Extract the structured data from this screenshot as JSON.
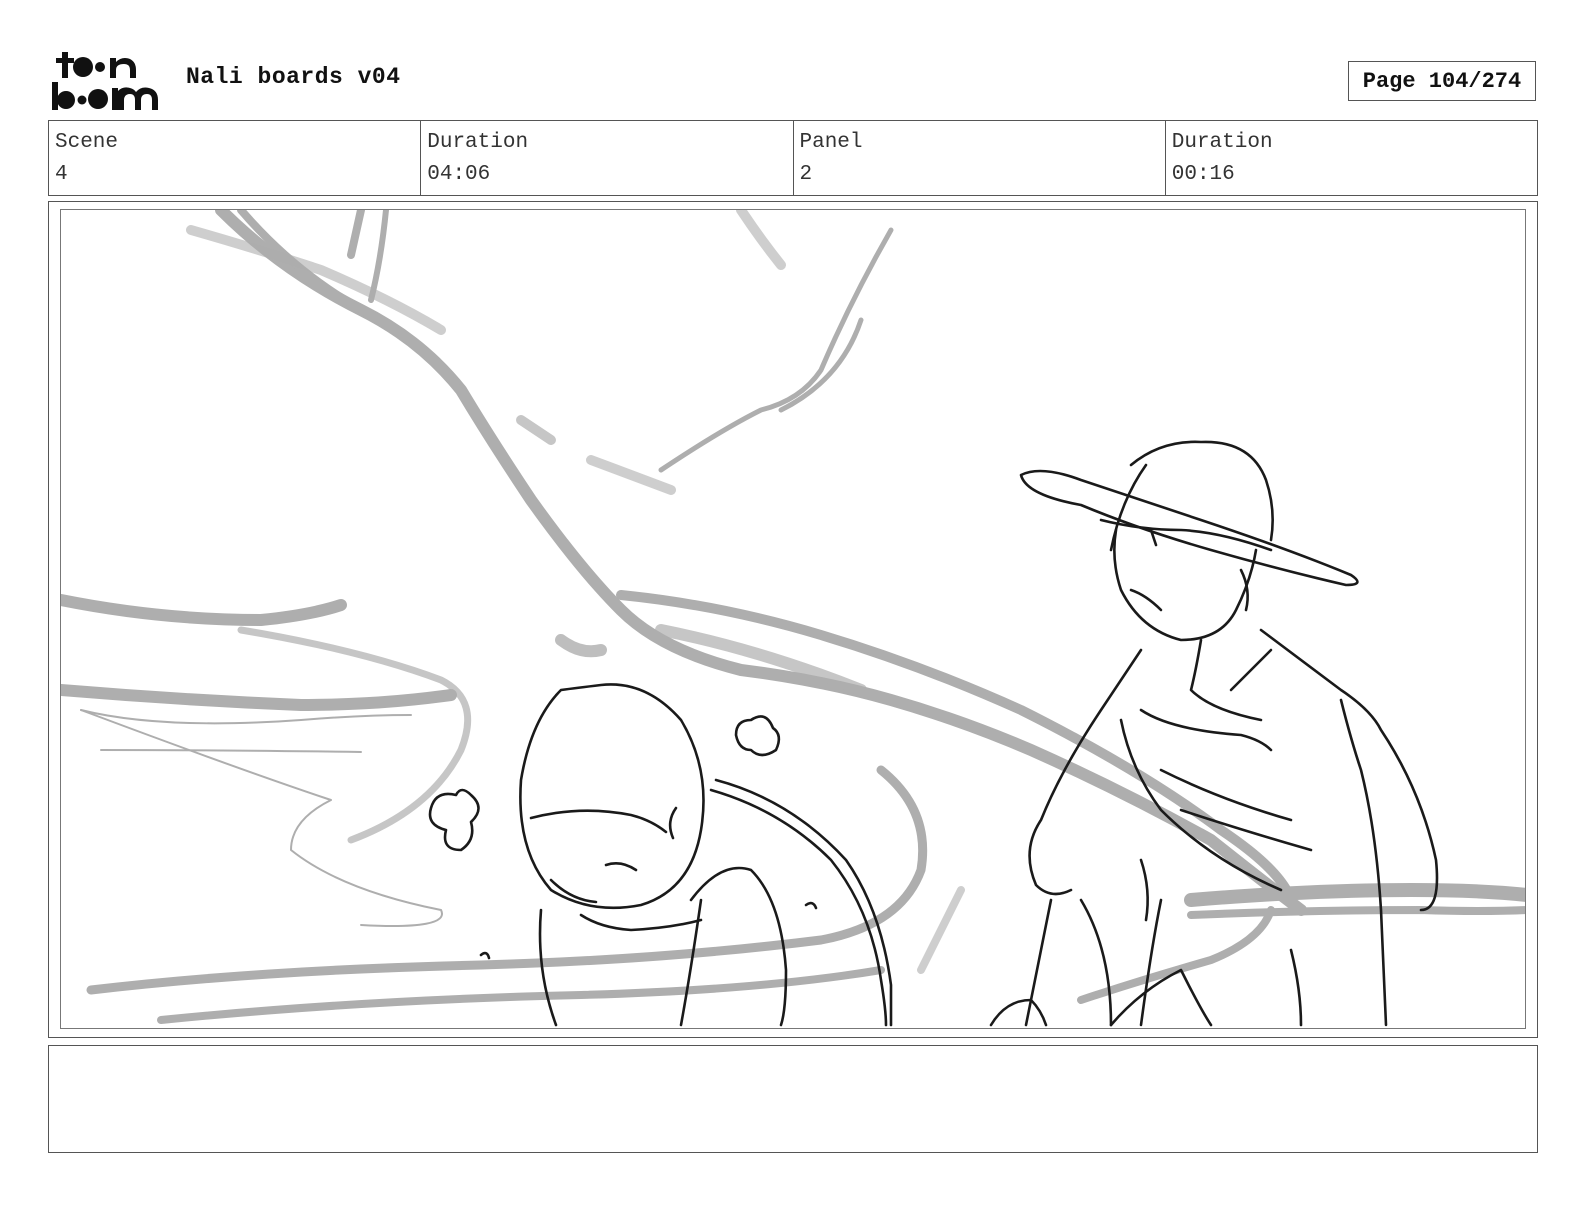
{
  "header": {
    "logo_text": "toonboom",
    "title": "Nali boards v04",
    "page_label": "Page 104/274"
  },
  "info": {
    "scene_label": "Scene",
    "scene_value": "4",
    "scene_duration_label": "Duration",
    "scene_duration_value": "04:06",
    "panel_label": "Panel",
    "panel_value": "2",
    "panel_duration_label": "Duration",
    "panel_duration_value": "00:16"
  },
  "notes": {
    "text": ""
  },
  "colors": {
    "border": "#555555",
    "sketch_dark": "#1a1a1a",
    "sketch_grey": "#9a9a9a"
  }
}
